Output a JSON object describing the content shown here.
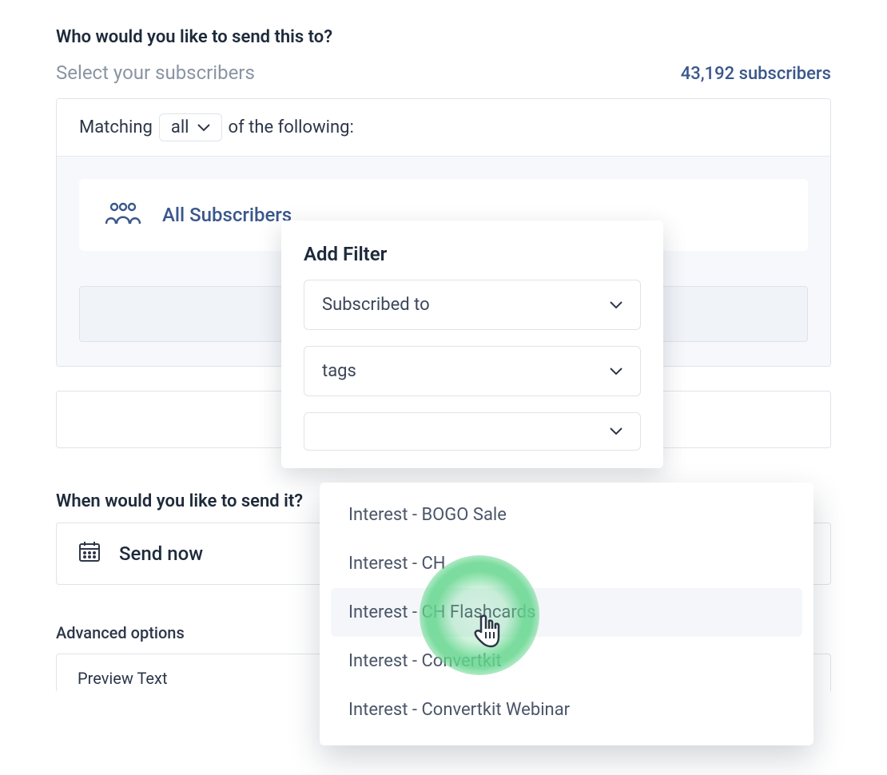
{
  "heading": "Who would you like to send this to?",
  "subheading": "Select your subscribers",
  "subscriber_count_label": "43,192 subscribers",
  "match": {
    "prefix": "Matching",
    "mode": "all",
    "suffix": "of the following:"
  },
  "all_subscribers_label": "All Subscribers",
  "add_filter": {
    "title": "Add Filter",
    "field1": "Subscribed to",
    "field2": "tags",
    "field3": ""
  },
  "tag_options": [
    "Interest - BOGO Sale",
    "Interest - CH",
    "Interest - CH Flashcards",
    "Interest - Convertkit",
    "Interest - Convertkit Webinar"
  ],
  "hovered_option_index": 2,
  "schedule_heading": "When would you like to send it?",
  "send_now_label": "Send now",
  "advanced_heading": "Advanced options",
  "preview_text_label": "Preview Text"
}
